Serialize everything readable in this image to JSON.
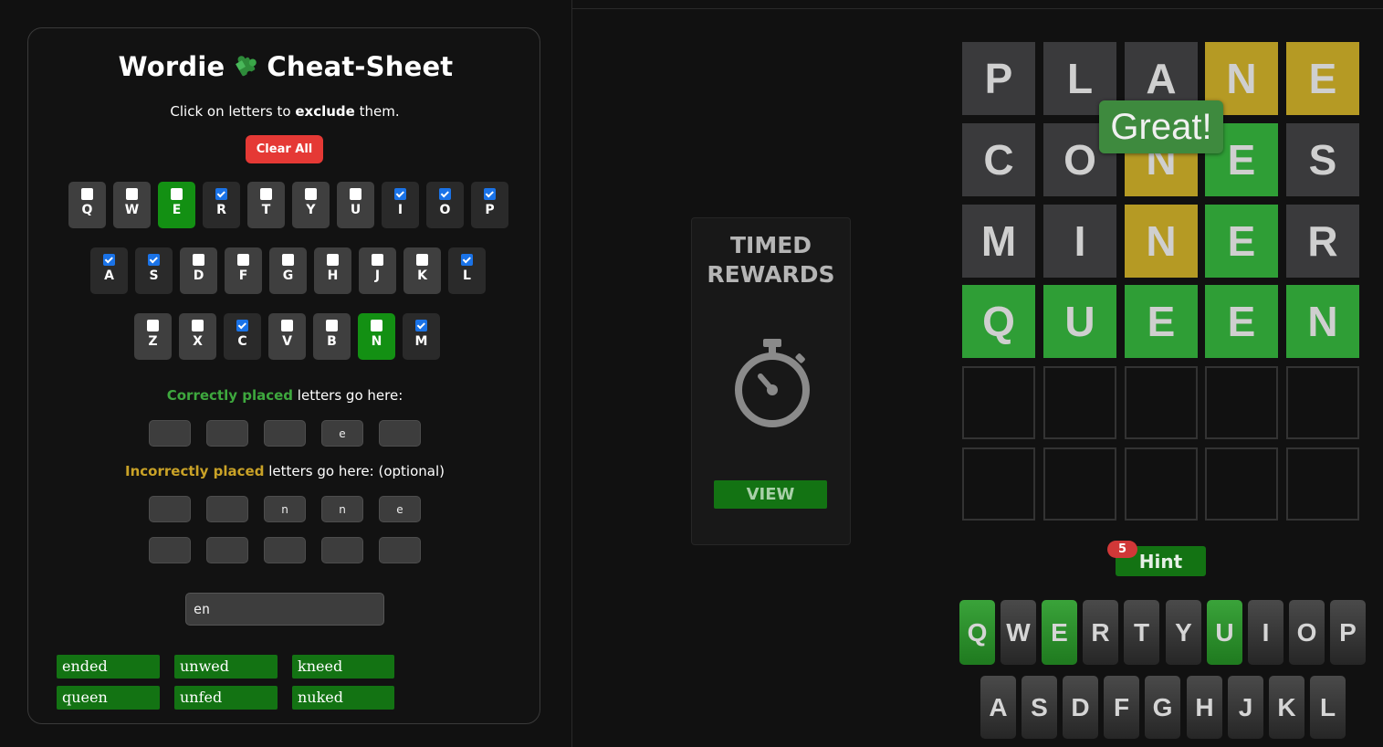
{
  "cheatsheet": {
    "title_left": "Wordie",
    "title_right": "Cheat-Sheet",
    "puzzle_icon": "puzzle-piece-icon",
    "instruction_pre": "Click on letters to ",
    "instruction_bold": "exclude",
    "instruction_post": " them.",
    "clear_label": "Clear All",
    "rows": [
      [
        {
          "letter": "Q",
          "checked": false,
          "state": "normal"
        },
        {
          "letter": "W",
          "checked": false,
          "state": "normal"
        },
        {
          "letter": "E",
          "checked": false,
          "state": "green"
        },
        {
          "letter": "R",
          "checked": true,
          "state": "dark"
        },
        {
          "letter": "T",
          "checked": false,
          "state": "normal"
        },
        {
          "letter": "Y",
          "checked": false,
          "state": "normal"
        },
        {
          "letter": "U",
          "checked": false,
          "state": "normal"
        },
        {
          "letter": "I",
          "checked": true,
          "state": "dark"
        },
        {
          "letter": "O",
          "checked": true,
          "state": "dark"
        },
        {
          "letter": "P",
          "checked": true,
          "state": "dark"
        }
      ],
      [
        {
          "letter": "A",
          "checked": true,
          "state": "dark"
        },
        {
          "letter": "S",
          "checked": true,
          "state": "dark"
        },
        {
          "letter": "D",
          "checked": false,
          "state": "normal"
        },
        {
          "letter": "F",
          "checked": false,
          "state": "normal"
        },
        {
          "letter": "G",
          "checked": false,
          "state": "normal"
        },
        {
          "letter": "H",
          "checked": false,
          "state": "normal"
        },
        {
          "letter": "J",
          "checked": false,
          "state": "normal"
        },
        {
          "letter": "K",
          "checked": false,
          "state": "normal"
        },
        {
          "letter": "L",
          "checked": true,
          "state": "dark"
        }
      ],
      [
        {
          "letter": "Z",
          "checked": false,
          "state": "normal"
        },
        {
          "letter": "X",
          "checked": false,
          "state": "normal"
        },
        {
          "letter": "C",
          "checked": true,
          "state": "dark"
        },
        {
          "letter": "V",
          "checked": false,
          "state": "normal"
        },
        {
          "letter": "B",
          "checked": false,
          "state": "normal"
        },
        {
          "letter": "N",
          "checked": false,
          "state": "green"
        },
        {
          "letter": "M",
          "checked": true,
          "state": "dark"
        }
      ]
    ],
    "correct_label_hl": "Correctly placed",
    "correct_label_rest": " letters go here:",
    "correct_slots": [
      "",
      "",
      "",
      "e",
      ""
    ],
    "incorrect_label_hl": "Incorrectly placed",
    "incorrect_label_rest": " letters go here: (optional)",
    "incorrect_slots_1": [
      "",
      "",
      "n",
      "n",
      "e"
    ],
    "incorrect_slots_2": [
      "",
      "",
      "",
      "",
      ""
    ],
    "search_value": "en",
    "words": [
      "ended",
      "unwed",
      "kneed",
      "queen",
      "unfed",
      "nuked"
    ]
  },
  "rewards": {
    "title_line1": "TIMED",
    "title_line2": "REWARDS",
    "icon": "stopwatch-icon",
    "view_label": "VIEW"
  },
  "game": {
    "rows": [
      [
        {
          "l": "P",
          "s": "gray"
        },
        {
          "l": "L",
          "s": "gray"
        },
        {
          "l": "A",
          "s": "gray"
        },
        {
          "l": "N",
          "s": "yellow"
        },
        {
          "l": "E",
          "s": "yellow"
        }
      ],
      [
        {
          "l": "C",
          "s": "gray"
        },
        {
          "l": "O",
          "s": "gray"
        },
        {
          "l": "N",
          "s": "yellow"
        },
        {
          "l": "E",
          "s": "green"
        },
        {
          "l": "S",
          "s": "gray"
        }
      ],
      [
        {
          "l": "M",
          "s": "gray"
        },
        {
          "l": "I",
          "s": "gray"
        },
        {
          "l": "N",
          "s": "yellow"
        },
        {
          "l": "E",
          "s": "green"
        },
        {
          "l": "R",
          "s": "gray"
        }
      ],
      [
        {
          "l": "Q",
          "s": "green"
        },
        {
          "l": "U",
          "s": "green"
        },
        {
          "l": "E",
          "s": "green"
        },
        {
          "l": "E",
          "s": "green"
        },
        {
          "l": "N",
          "s": "green"
        }
      ],
      [
        {
          "l": "",
          "s": "empty"
        },
        {
          "l": "",
          "s": "empty"
        },
        {
          "l": "",
          "s": "empty"
        },
        {
          "l": "",
          "s": "empty"
        },
        {
          "l": "",
          "s": "empty"
        }
      ],
      [
        {
          "l": "",
          "s": "empty"
        },
        {
          "l": "",
          "s": "empty"
        },
        {
          "l": "",
          "s": "empty"
        },
        {
          "l": "",
          "s": "empty"
        },
        {
          "l": "",
          "s": "empty"
        }
      ]
    ],
    "toast": "Great!",
    "hint_label": "Hint",
    "hint_count": "5",
    "keyboard": [
      [
        {
          "k": "Q",
          "s": "green"
        },
        {
          "k": "W",
          "s": "normal"
        },
        {
          "k": "E",
          "s": "green"
        },
        {
          "k": "R",
          "s": "normal"
        },
        {
          "k": "T",
          "s": "normal"
        },
        {
          "k": "Y",
          "s": "normal"
        },
        {
          "k": "U",
          "s": "green"
        },
        {
          "k": "I",
          "s": "normal"
        },
        {
          "k": "O",
          "s": "normal"
        },
        {
          "k": "P",
          "s": "normal"
        }
      ],
      [
        {
          "k": "A",
          "s": "normal"
        },
        {
          "k": "S",
          "s": "normal"
        },
        {
          "k": "D",
          "s": "normal"
        },
        {
          "k": "F",
          "s": "normal"
        },
        {
          "k": "G",
          "s": "normal"
        },
        {
          "k": "H",
          "s": "normal"
        },
        {
          "k": "J",
          "s": "normal"
        },
        {
          "k": "K",
          "s": "normal"
        },
        {
          "k": "L",
          "s": "normal"
        }
      ]
    ]
  }
}
